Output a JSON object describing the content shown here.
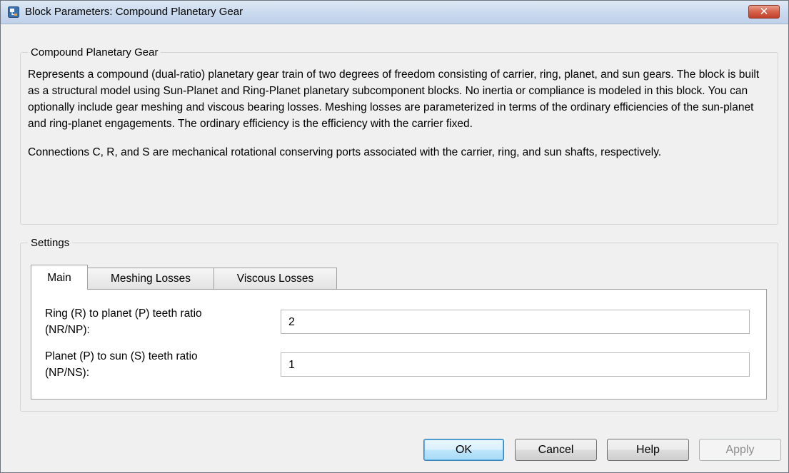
{
  "window": {
    "title": "Block Parameters: Compound Planetary Gear",
    "close_glyph": "✕"
  },
  "description": {
    "group_title": "Compound Planetary Gear",
    "paragraphs": [
      "Represents a compound (dual-ratio) planetary gear train of two degrees of freedom consisting of carrier, ring, planet, and sun gears. The block is built as a structural model using Sun-Planet and Ring-Planet planetary subcomponent blocks. No inertia or compliance is modeled in this block. You can optionally include gear meshing and viscous bearing losses. Meshing losses are parameterized in terms of the ordinary efficiencies of the sun-planet and ring-planet engagements. The ordinary efficiency is the efficiency with the carrier fixed.",
      "Connections C, R, and S are mechanical rotational conserving ports associated with the carrier, ring, and sun shafts, respectively."
    ]
  },
  "settings": {
    "group_title": "Settings",
    "tabs": [
      {
        "label": "Main",
        "active": true
      },
      {
        "label": "Meshing Losses",
        "active": false
      },
      {
        "label": "Viscous Losses",
        "active": false
      }
    ],
    "params": [
      {
        "label_line1": "Ring (R) to planet (P) teeth ratio",
        "label_line2": "(NR/NP):",
        "value": "2"
      },
      {
        "label_line1": "Planet (P) to sun (S) teeth ratio",
        "label_line2": "(NP/NS):",
        "value": "1"
      }
    ]
  },
  "buttons": {
    "ok": "OK",
    "cancel": "Cancel",
    "help": "Help",
    "apply": "Apply"
  },
  "colors": {
    "accent": "#3c7fb1",
    "close": "#c0402a"
  },
  "icons": {
    "app": "simulink-block-icon",
    "close": "close-icon"
  }
}
